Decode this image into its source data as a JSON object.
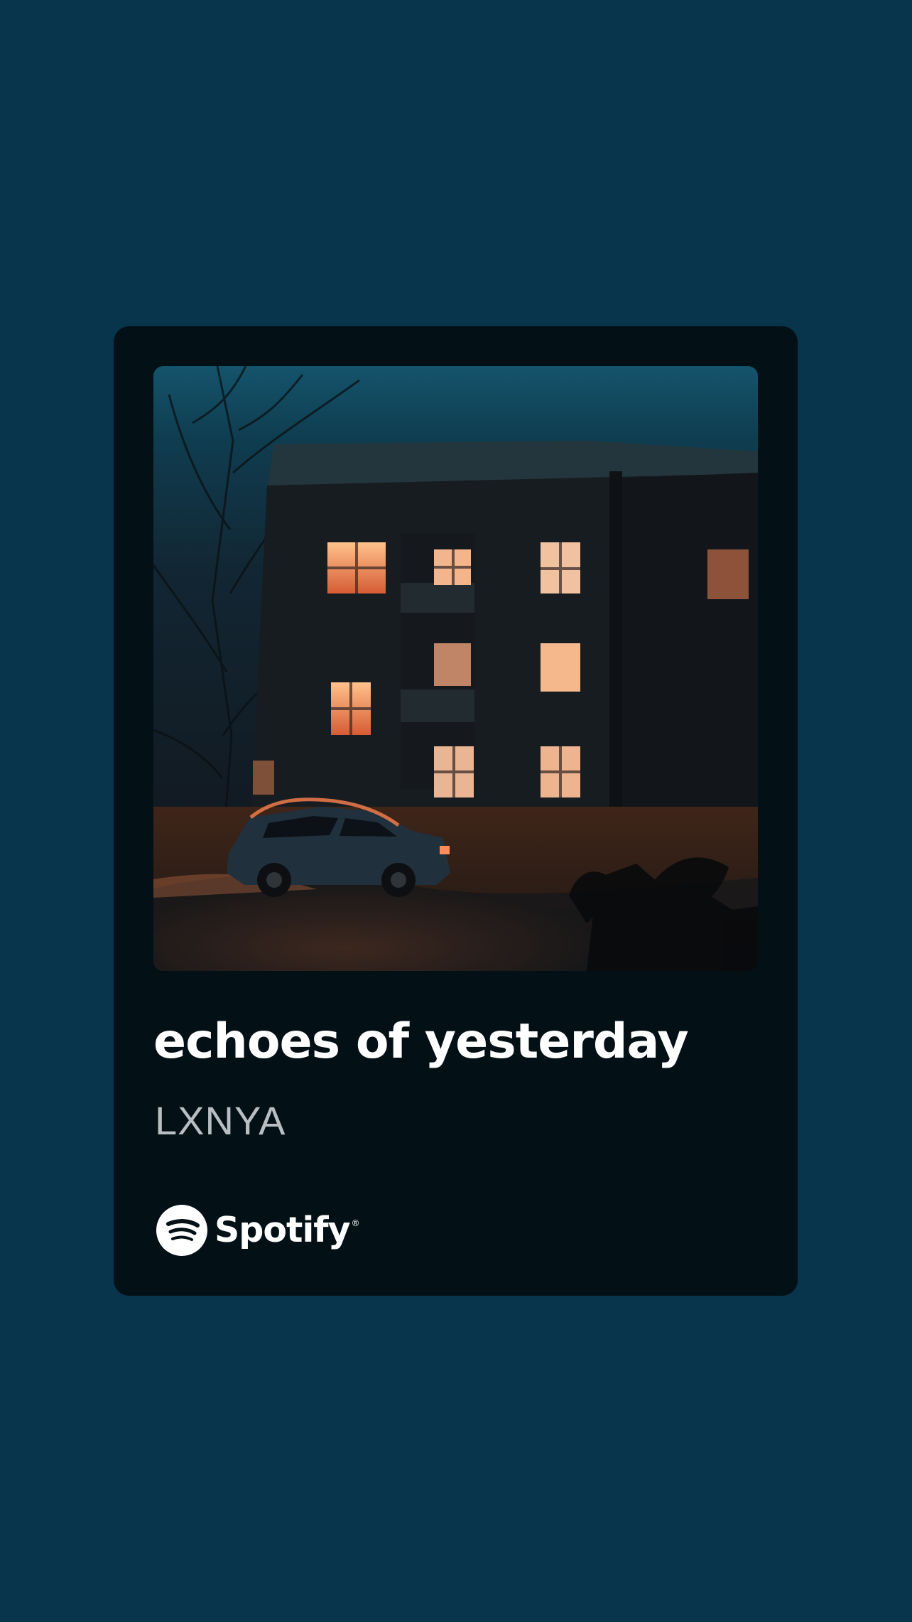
{
  "track": {
    "title": "echoes of yesterday",
    "artist": "LXNYA"
  },
  "brand": {
    "name": "Spotify",
    "mark": "®",
    "icon": "spotify-icon"
  },
  "artwork": {
    "subject": "apartment building at night with lit windows and parked car"
  },
  "colors": {
    "background": "#08344c",
    "card": "#031117",
    "title": "#ffffff",
    "artist": "#b8bec1",
    "window_glow": "#f59a62"
  }
}
